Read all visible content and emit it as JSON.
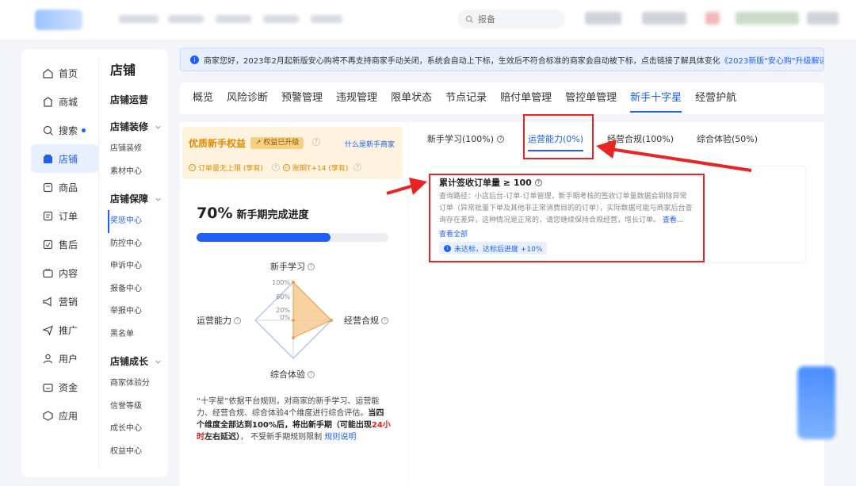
{
  "search": {
    "placeholder": "报备"
  },
  "sidebar_nav": [
    {
      "label": "首页",
      "icon": "home-icon"
    },
    {
      "label": "商城",
      "icon": "store-icon"
    },
    {
      "label": "搜索",
      "icon": "search-icon"
    },
    {
      "label": "店铺",
      "icon": "shop-icon",
      "active": true
    },
    {
      "label": "商品",
      "icon": "product-icon"
    },
    {
      "label": "订单",
      "icon": "order-icon"
    },
    {
      "label": "售后",
      "icon": "aftersale-icon"
    },
    {
      "label": "内容",
      "icon": "content-icon"
    },
    {
      "label": "营销",
      "icon": "marketing-icon"
    },
    {
      "label": "推广",
      "icon": "promote-icon"
    },
    {
      "label": "用户",
      "icon": "user-icon"
    },
    {
      "label": "资金",
      "icon": "wallet-icon"
    },
    {
      "label": "应用",
      "icon": "app-icon"
    }
  ],
  "subnav": {
    "title": "店铺",
    "sections": [
      {
        "label": "店铺运营",
        "items": []
      },
      {
        "label": "店铺装修",
        "items": [
          "店铺装修",
          "素材中心"
        ]
      },
      {
        "label": "店铺保障",
        "items": [
          "奖惩中心",
          "防控中心",
          "申诉中心",
          "报备中心",
          "举报中心",
          "黑名单"
        ]
      },
      {
        "label": "店铺成长",
        "items": [
          "商家体验分",
          "信誉等级",
          "成长中心",
          "权益中心"
        ]
      }
    ]
  },
  "notice": {
    "text": "商家您好，2023年2月起新版安心购将不再支持商家手动关闭，系统会自动上下标，生效后不符合标准的商家会自动被下标，点击链接了解具体变化",
    "link": "《2023新版\"安心购\"升级解读》",
    "end": "。"
  },
  "tabs": [
    "概览",
    "风险诊断",
    "预警管理",
    "违规管理",
    "限单状态",
    "节点记录",
    "赔付单管理",
    "管控单管理",
    "新手十字星",
    "经营护航"
  ],
  "active_tab": "新手十字星",
  "benefit": {
    "title": "优质新手权益",
    "badge": "权益已升级",
    "link": "什么是新手商家",
    "perks": [
      "订单量无上限 (享有)",
      "账期T+14 (享有)"
    ]
  },
  "progress": {
    "percent_text": "70%",
    "label": "新手期完成进度",
    "value": 0.7
  },
  "radar": {
    "axes": [
      "新手学习",
      "经营合规",
      "综合体验",
      "运营能力"
    ],
    "ticks": [
      "100%",
      "60%",
      "20%",
      "0%"
    ],
    "values": [
      100,
      100,
      0,
      0
    ]
  },
  "desc": {
    "p1": "“十字星”依据平台规则，对商家的新手学习、运营能力、经营合规、综合体验4个维度进行综合评估。",
    "p2": "当四个维度全部达到100%后，将出新手期（可能出现",
    "red": "24小时",
    "p3": "左右延迟）",
    "p4": "， 不受新手期规则限制",
    "link": "规则说明"
  },
  "subtabs": [
    "新手学习(100%)",
    "运营能力(0%)",
    "经营合规(100%)",
    "综合体验(50%)"
  ],
  "active_subtab": "运营能力(0%)",
  "task": {
    "title": "累计签收订单量 ≥ 100",
    "desc": "查询路径：小店后台-订单-订单管理，新手期考核的签收订单量数据会剔除异常订单（异常批量下单及其他非正常消费目的的订单），实际数据可能与商家后台查询存在差异，这种情况是正常的，请您继续保持合规经营，增长订单。",
    "more": "查看...",
    "view_all": "查看全部",
    "status": "未达标，达标后进度 +10%"
  },
  "colors": {
    "accent": "#1f5ff5",
    "highlight": "#e82424",
    "benefit": "#e08a00"
  }
}
